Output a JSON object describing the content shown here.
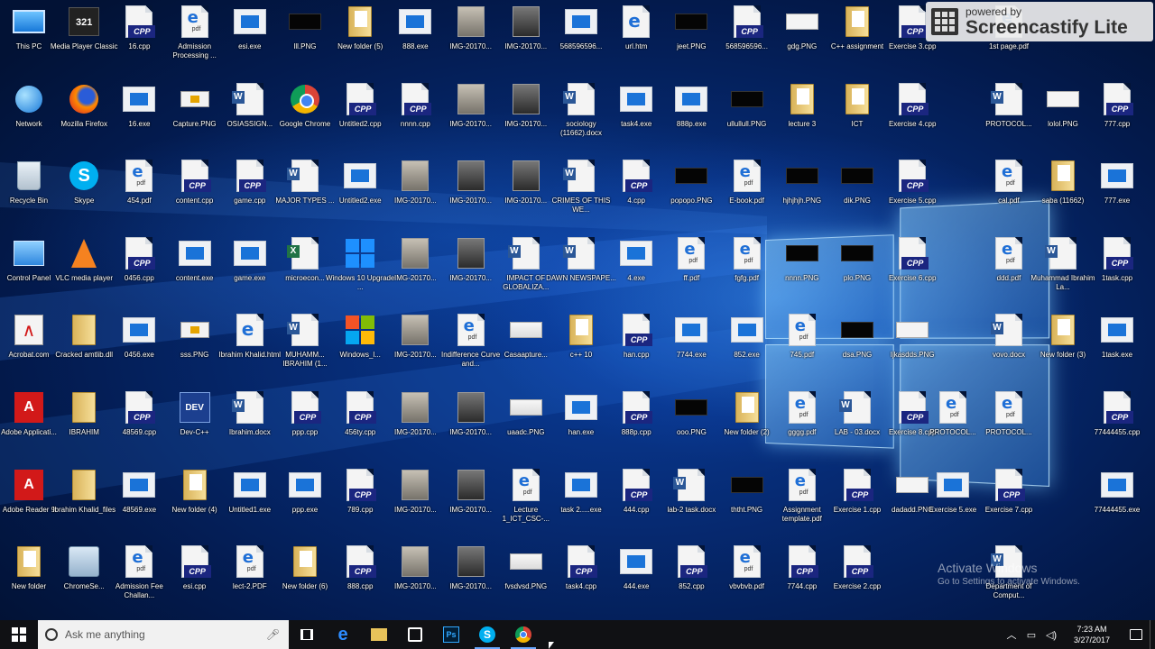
{
  "taskbar": {
    "search_placeholder": "Ask me anything",
    "clock_time": "7:23 AM",
    "clock_date": "3/27/2017",
    "pinned": [
      "task-view",
      "edge",
      "file-explorer",
      "store",
      "photoshop",
      "skype",
      "chrome"
    ]
  },
  "watermark": {
    "powered_by": "powered by",
    "brand": "Screencastify Lite"
  },
  "activation": {
    "title": "Activate Windows",
    "subtitle": "Go to Settings to activate Windows."
  },
  "colors": {
    "accent": "#1e90ff",
    "taskbar": "#101114",
    "cpp_badge": "#1b2680"
  },
  "desktop_icons": [
    {
      "col": 0,
      "row": 0,
      "label": "This PC",
      "icon": "thispc"
    },
    {
      "col": 0,
      "row": 1,
      "label": "Network",
      "icon": "network"
    },
    {
      "col": 0,
      "row": 2,
      "label": "Recycle Bin",
      "icon": "recycle"
    },
    {
      "col": 0,
      "row": 3,
      "label": "Control Panel",
      "icon": "control"
    },
    {
      "col": 0,
      "row": 4,
      "label": "Acrobat.com",
      "icon": "acrobat"
    },
    {
      "col": 0,
      "row": 5,
      "label": "Adobe Applicati...",
      "icon": "adobe"
    },
    {
      "col": 0,
      "row": 6,
      "label": "Adobe Reader 9",
      "icon": "adobe"
    },
    {
      "col": 0,
      "row": 7,
      "label": "New folder",
      "icon": "folder-paper"
    },
    {
      "col": 1,
      "row": 0,
      "label": "Media Player Classic",
      "icon": "media321"
    },
    {
      "col": 1,
      "row": 1,
      "label": "Mozilla Firefox",
      "icon": "firefox"
    },
    {
      "col": 1,
      "row": 2,
      "label": "Skype",
      "icon": "skype"
    },
    {
      "col": 1,
      "row": 3,
      "label": "VLC media player",
      "icon": "vlc"
    },
    {
      "col": 1,
      "row": 4,
      "label": "Cracked amtlib.dll",
      "icon": "folder"
    },
    {
      "col": 1,
      "row": 5,
      "label": "IBRAHIM",
      "icon": "folder"
    },
    {
      "col": 1,
      "row": 6,
      "label": "Ibrahim Khalid_files",
      "icon": "folder"
    },
    {
      "col": 1,
      "row": 7,
      "label": "ChromeSe...",
      "icon": "chromesetup"
    },
    {
      "col": 2,
      "row": 0,
      "label": "16.cpp",
      "icon": "cpp"
    },
    {
      "col": 2,
      "row": 1,
      "label": "16.exe",
      "icon": "exe"
    },
    {
      "col": 2,
      "row": 2,
      "label": "454.pdf",
      "icon": "pdf"
    },
    {
      "col": 2,
      "row": 3,
      "label": "0456.cpp",
      "icon": "cpp"
    },
    {
      "col": 2,
      "row": 4,
      "label": "0456.exe",
      "icon": "exe"
    },
    {
      "col": 2,
      "row": 5,
      "label": "48569.cpp",
      "icon": "cpp"
    },
    {
      "col": 2,
      "row": 6,
      "label": "48569.exe",
      "icon": "exe"
    },
    {
      "col": 2,
      "row": 7,
      "label": "Admission Fee Challan...",
      "icon": "pdf"
    },
    {
      "col": 3,
      "row": 0,
      "label": "Admission Processing ...",
      "icon": "pdf"
    },
    {
      "col": 3,
      "row": 1,
      "label": "Capture.PNG",
      "icon": "pp"
    },
    {
      "col": 3,
      "row": 2,
      "label": "content.cpp",
      "icon": "cpp"
    },
    {
      "col": 3,
      "row": 3,
      "label": "content.exe",
      "icon": "exe"
    },
    {
      "col": 3,
      "row": 4,
      "label": "sss.PNG",
      "icon": "pp"
    },
    {
      "col": 3,
      "row": 5,
      "label": "Dev-C++",
      "icon": "devcpp"
    },
    {
      "col": 3,
      "row": 6,
      "label": "New folder (4)",
      "icon": "folder-paper"
    },
    {
      "col": 3,
      "row": 7,
      "label": "esi.cpp",
      "icon": "cpp"
    },
    {
      "col": 4,
      "row": 0,
      "label": "esi.exe",
      "icon": "exe"
    },
    {
      "col": 4,
      "row": 1,
      "label": "OSIASSIGN...",
      "icon": "word"
    },
    {
      "col": 4,
      "row": 2,
      "label": "game.cpp",
      "icon": "cpp"
    },
    {
      "col": 4,
      "row": 3,
      "label": "game.exe",
      "icon": "exe"
    },
    {
      "col": 4,
      "row": 4,
      "label": "Ibrahim Khalid.html",
      "icon": "html"
    },
    {
      "col": 4,
      "row": 5,
      "label": "Ibrahim.docx",
      "icon": "word"
    },
    {
      "col": 4,
      "row": 6,
      "label": "Untitled1.exe",
      "icon": "exe"
    },
    {
      "col": 4,
      "row": 7,
      "label": "lect-2.PDF",
      "icon": "pdf"
    },
    {
      "col": 5,
      "row": 0,
      "label": "lll.PNG",
      "icon": "black"
    },
    {
      "col": 5,
      "row": 1,
      "label": "Google Chrome",
      "icon": "chrome"
    },
    {
      "col": 5,
      "row": 2,
      "label": "MAJOR TYPES ...",
      "icon": "word"
    },
    {
      "col": 5,
      "row": 3,
      "label": "microecon...",
      "icon": "xls"
    },
    {
      "col": 5,
      "row": 4,
      "label": "MUHAMM... IBRAHIM (1...",
      "icon": "word"
    },
    {
      "col": 5,
      "row": 5,
      "label": "ppp.cpp",
      "icon": "cpp"
    },
    {
      "col": 5,
      "row": 6,
      "label": "ppp.exe",
      "icon": "exe"
    },
    {
      "col": 5,
      "row": 7,
      "label": "New folder (6)",
      "icon": "folder-paper"
    },
    {
      "col": 6,
      "row": 0,
      "label": "New folder (5)",
      "icon": "folder-paper"
    },
    {
      "col": 6,
      "row": 1,
      "label": "Untitled2.cpp",
      "icon": "cpp"
    },
    {
      "col": 6,
      "row": 2,
      "label": "Untitled2.exe",
      "icon": "exe"
    },
    {
      "col": 6,
      "row": 3,
      "label": "Windows 10 Upgrade ...",
      "icon": "win10"
    },
    {
      "col": 6,
      "row": 4,
      "label": "Windows_l...",
      "icon": "winlive"
    },
    {
      "col": 6,
      "row": 5,
      "label": "456ty.cpp",
      "icon": "cpp"
    },
    {
      "col": 6,
      "row": 6,
      "label": "789.cpp",
      "icon": "cpp"
    },
    {
      "col": 6,
      "row": 7,
      "label": "888.cpp",
      "icon": "cpp"
    },
    {
      "col": 7,
      "row": 0,
      "label": "888.exe",
      "icon": "exe"
    },
    {
      "col": 7,
      "row": 1,
      "label": "nnnn.cpp",
      "icon": "cpp"
    },
    {
      "col": 7,
      "row": 2,
      "label": "IMG-20170...",
      "icon": "img"
    },
    {
      "col": 7,
      "row": 3,
      "label": "IMG-20170...",
      "icon": "img"
    },
    {
      "col": 7,
      "row": 4,
      "label": "IMG-20170...",
      "icon": "img"
    },
    {
      "col": 7,
      "row": 5,
      "label": "IMG-20170...",
      "icon": "img"
    },
    {
      "col": 7,
      "row": 6,
      "label": "IMG-20170...",
      "icon": "img"
    },
    {
      "col": 7,
      "row": 7,
      "label": "IMG-20170...",
      "icon": "img"
    },
    {
      "col": 8,
      "row": 0,
      "label": "IMG-20170...",
      "icon": "img"
    },
    {
      "col": 8,
      "row": 1,
      "label": "IMG-20170...",
      "icon": "img"
    },
    {
      "col": 8,
      "row": 2,
      "label": "IMG-20170...",
      "icon": "img-dark"
    },
    {
      "col": 8,
      "row": 3,
      "label": "IMG-20170...",
      "icon": "img-dark"
    },
    {
      "col": 8,
      "row": 4,
      "label": "Indifference Curve and...",
      "icon": "pdf"
    },
    {
      "col": 8,
      "row": 5,
      "label": "IMG-20170...",
      "icon": "img-dark"
    },
    {
      "col": 8,
      "row": 6,
      "label": "IMG-20170...",
      "icon": "img-dark"
    },
    {
      "col": 8,
      "row": 7,
      "label": "IMG-20170...",
      "icon": "img-dark"
    },
    {
      "col": 9,
      "row": 0,
      "label": "IMG-20170...",
      "icon": "img-dark"
    },
    {
      "col": 9,
      "row": 1,
      "label": "IMG-20170...",
      "icon": "img-dark"
    },
    {
      "col": 9,
      "row": 2,
      "label": "IMG-20170...",
      "icon": "img-dark"
    },
    {
      "col": 9,
      "row": 3,
      "label": "IMPACT OF GLOBALIZA...",
      "icon": "word"
    },
    {
      "col": 9,
      "row": 4,
      "label": "Casaapture...",
      "icon": "screenshot"
    },
    {
      "col": 9,
      "row": 5,
      "label": "uaadc.PNG",
      "icon": "screenshot"
    },
    {
      "col": 9,
      "row": 6,
      "label": "Lecture 1_ICT_CSC-...",
      "icon": "pdf"
    },
    {
      "col": 9,
      "row": 7,
      "label": "fvsdvsd.PNG",
      "icon": "screenshot"
    },
    {
      "col": 10,
      "row": 0,
      "label": "568596596...",
      "icon": "exe"
    },
    {
      "col": 10,
      "row": 1,
      "label": "sociology (11662).docx",
      "icon": "word"
    },
    {
      "col": 10,
      "row": 2,
      "label": "CRIMES OF THIS WE...",
      "icon": "word"
    },
    {
      "col": 10,
      "row": 3,
      "label": "DAWN NEWSPAPE...",
      "icon": "word"
    },
    {
      "col": 10,
      "row": 4,
      "label": "c++ 10",
      "icon": "folder-paper"
    },
    {
      "col": 10,
      "row": 5,
      "label": "han.exe",
      "icon": "exe"
    },
    {
      "col": 10,
      "row": 6,
      "label": "task 2.....exe",
      "icon": "exe"
    },
    {
      "col": 10,
      "row": 7,
      "label": "task4.cpp",
      "icon": "cpp"
    },
    {
      "col": 11,
      "row": 0,
      "label": "url.htm",
      "icon": "html"
    },
    {
      "col": 11,
      "row": 1,
      "label": "task4.exe",
      "icon": "exe"
    },
    {
      "col": 11,
      "row": 2,
      "label": "4.cpp",
      "icon": "cpp"
    },
    {
      "col": 11,
      "row": 3,
      "label": "4.exe",
      "icon": "exe"
    },
    {
      "col": 11,
      "row": 4,
      "label": "han.cpp",
      "icon": "cpp"
    },
    {
      "col": 11,
      "row": 5,
      "label": "888p.cpp",
      "icon": "cpp"
    },
    {
      "col": 11,
      "row": 6,
      "label": "444.cpp",
      "icon": "cpp"
    },
    {
      "col": 11,
      "row": 7,
      "label": "444.exe",
      "icon": "exe"
    },
    {
      "col": 12,
      "row": 0,
      "label": "jeet.PNG",
      "icon": "black"
    },
    {
      "col": 12,
      "row": 1,
      "label": "888p.exe",
      "icon": "exe"
    },
    {
      "col": 12,
      "row": 2,
      "label": "popopo.PNG",
      "icon": "black"
    },
    {
      "col": 12,
      "row": 3,
      "label": "ff.pdf",
      "icon": "pdf"
    },
    {
      "col": 12,
      "row": 4,
      "label": "7744.exe",
      "icon": "exe"
    },
    {
      "col": 12,
      "row": 5,
      "label": "ooo.PNG",
      "icon": "black"
    },
    {
      "col": 12,
      "row": 6,
      "label": "lab-2 task.docx",
      "icon": "word"
    },
    {
      "col": 12,
      "row": 7,
      "label": "852.cpp",
      "icon": "cpp"
    },
    {
      "col": 13,
      "row": 0,
      "label": "568596596...",
      "icon": "cpp"
    },
    {
      "col": 13,
      "row": 1,
      "label": "ullullull.PNG",
      "icon": "black"
    },
    {
      "col": 13,
      "row": 2,
      "label": "E-book.pdf",
      "icon": "pdf"
    },
    {
      "col": 13,
      "row": 3,
      "label": "fgfg.pdf",
      "icon": "pdf"
    },
    {
      "col": 13,
      "row": 4,
      "label": "852.exe",
      "icon": "exe"
    },
    {
      "col": 13,
      "row": 5,
      "label": "New folder (2)",
      "icon": "folder-paper"
    },
    {
      "col": 13,
      "row": 6,
      "label": "ththt.PNG",
      "icon": "black"
    },
    {
      "col": 13,
      "row": 7,
      "label": "vbvbvb.pdf",
      "icon": "pdf"
    },
    {
      "col": 14,
      "row": 0,
      "label": "gdg.PNG",
      "icon": "white"
    },
    {
      "col": 14,
      "row": 1,
      "label": "lecture 3",
      "icon": "folder-paper"
    },
    {
      "col": 14,
      "row": 2,
      "label": "hjhjhjh.PNG",
      "icon": "black"
    },
    {
      "col": 14,
      "row": 3,
      "label": "nnnn.PNG",
      "icon": "black"
    },
    {
      "col": 14,
      "row": 4,
      "label": "745.pdf",
      "icon": "pdf"
    },
    {
      "col": 14,
      "row": 5,
      "label": "gggg.pdf",
      "icon": "pdf"
    },
    {
      "col": 14,
      "row": 6,
      "label": "Assignment template.pdf",
      "icon": "pdf"
    },
    {
      "col": 14,
      "row": 7,
      "label": "7744.cpp",
      "icon": "cpp"
    },
    {
      "col": 15,
      "row": 0,
      "label": "C++ assignment",
      "icon": "folder-paper"
    },
    {
      "col": 15,
      "row": 1,
      "label": "ICT",
      "icon": "folder-paper"
    },
    {
      "col": 15,
      "row": 2,
      "label": "dik.PNG",
      "icon": "black"
    },
    {
      "col": 15,
      "row": 3,
      "label": "plo.PNG",
      "icon": "black"
    },
    {
      "col": 15,
      "row": 4,
      "label": "dsa.PNG",
      "icon": "black"
    },
    {
      "col": 15,
      "row": 5,
      "label": "LAB - 03.docx",
      "icon": "word"
    },
    {
      "col": 15,
      "row": 6,
      "label": "Exercise 1.cpp",
      "icon": "cpp"
    },
    {
      "col": 15,
      "row": 7,
      "label": "Exercise 2.cpp",
      "icon": "cpp"
    },
    {
      "col": 16,
      "row": 0,
      "label": "Exercise 3.cpp",
      "icon": "cpp"
    },
    {
      "col": 16,
      "row": 1,
      "label": "Exercise 4.cpp",
      "icon": "cpp"
    },
    {
      "col": 16,
      "row": 2,
      "label": "Exercise 5.cpp",
      "icon": "cpp"
    },
    {
      "col": 16,
      "row": 3,
      "label": "Exercise 6.cpp",
      "icon": "cpp"
    },
    {
      "col": 16,
      "row": 4,
      "label": "Ijkasdds.PNG",
      "icon": "white"
    },
    {
      "col": 16,
      "row": 5,
      "label": "Exercise 8.cpp",
      "icon": "cpp"
    },
    {
      "col": 16,
      "row": 6,
      "label": "dadadd.PNG",
      "icon": "white"
    },
    {
      "col": 17,
      "row": 5,
      "label": "PROTOCOL...",
      "icon": "pdf"
    },
    {
      "col": 17,
      "row": 6,
      "label": "Exercise 5.exe",
      "icon": "exe"
    },
    {
      "col": 18,
      "row": 0,
      "label": "1st page.pdf",
      "icon": "pdf"
    },
    {
      "col": 18,
      "row": 1,
      "label": "PROTOCOL...",
      "icon": "word"
    },
    {
      "col": 18,
      "row": 2,
      "label": "cal.pdf",
      "icon": "pdf"
    },
    {
      "col": 18,
      "row": 3,
      "label": "ddd.pdf",
      "icon": "pdf"
    },
    {
      "col": 18,
      "row": 4,
      "label": "vovo.docx",
      "icon": "word"
    },
    {
      "col": 18,
      "row": 5,
      "label": "PROTOCOL...",
      "icon": "pdf"
    },
    {
      "col": 18,
      "row": 6,
      "label": "Exercise 7.cpp",
      "icon": "cpp"
    },
    {
      "col": 18,
      "row": 7,
      "label": "Department of Comput...",
      "icon": "word"
    },
    {
      "col": 19,
      "row": 1,
      "label": "lolol.PNG",
      "icon": "white"
    },
    {
      "col": 19,
      "row": 2,
      "label": "saba (11662)",
      "icon": "folder-paper"
    },
    {
      "col": 19,
      "row": 3,
      "label": "Muhammad Ibrahim La...",
      "icon": "word"
    },
    {
      "col": 19,
      "row": 4,
      "label": "New folder (3)",
      "icon": "folder-paper"
    },
    {
      "col": 20,
      "row": 1,
      "label": "777.cpp",
      "icon": "cpp"
    },
    {
      "col": 20,
      "row": 2,
      "label": "777.exe",
      "icon": "exe"
    },
    {
      "col": 20,
      "row": 3,
      "label": "1task.cpp",
      "icon": "cpp"
    },
    {
      "col": 20,
      "row": 4,
      "label": "1task.exe",
      "icon": "exe"
    },
    {
      "col": 20,
      "row": 5,
      "label": "77444455.cpp",
      "icon": "cpp"
    },
    {
      "col": 20,
      "row": 6,
      "label": "77444455.exe",
      "icon": "exe"
    }
  ]
}
